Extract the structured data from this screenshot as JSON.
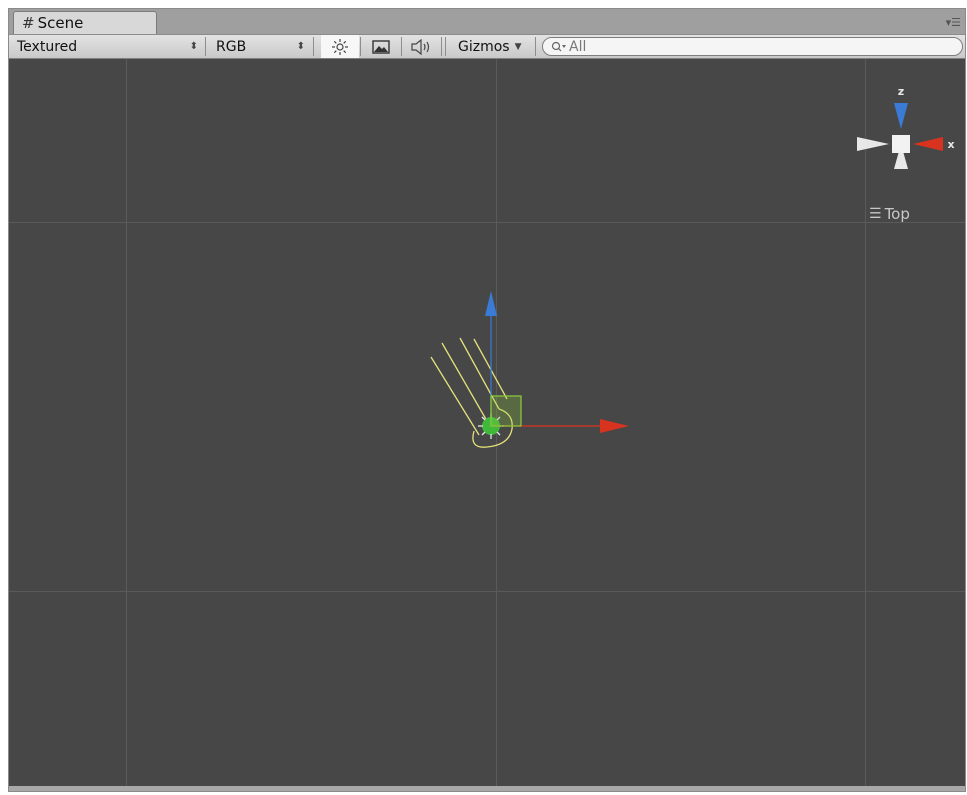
{
  "window": {
    "tab_label": "Scene",
    "tab_icon": "grid-icon"
  },
  "toolbar": {
    "render_mode": "Textured",
    "color_mode": "RGB",
    "lighting_icon": "sun-icon",
    "image_icon": "image-icon",
    "audio_icon": "speaker-icon",
    "gizmos_label": "Gizmos",
    "search_placeholder": "All"
  },
  "scene_gizmo": {
    "axis_z_label": "z",
    "axis_x_label": "x",
    "view_label": "Top",
    "colors": {
      "z": "#3a7bd5",
      "x": "#d8331f",
      "neutral": "#e8e8e8"
    }
  },
  "viewport": {
    "background_color": "#474747",
    "grid_color": "#5a5a5a",
    "light_color": "#e6e27a",
    "handle_colors": {
      "y": "#3a7bd5",
      "x": "#d8331f",
      "center": "#8ccf3a"
    }
  }
}
